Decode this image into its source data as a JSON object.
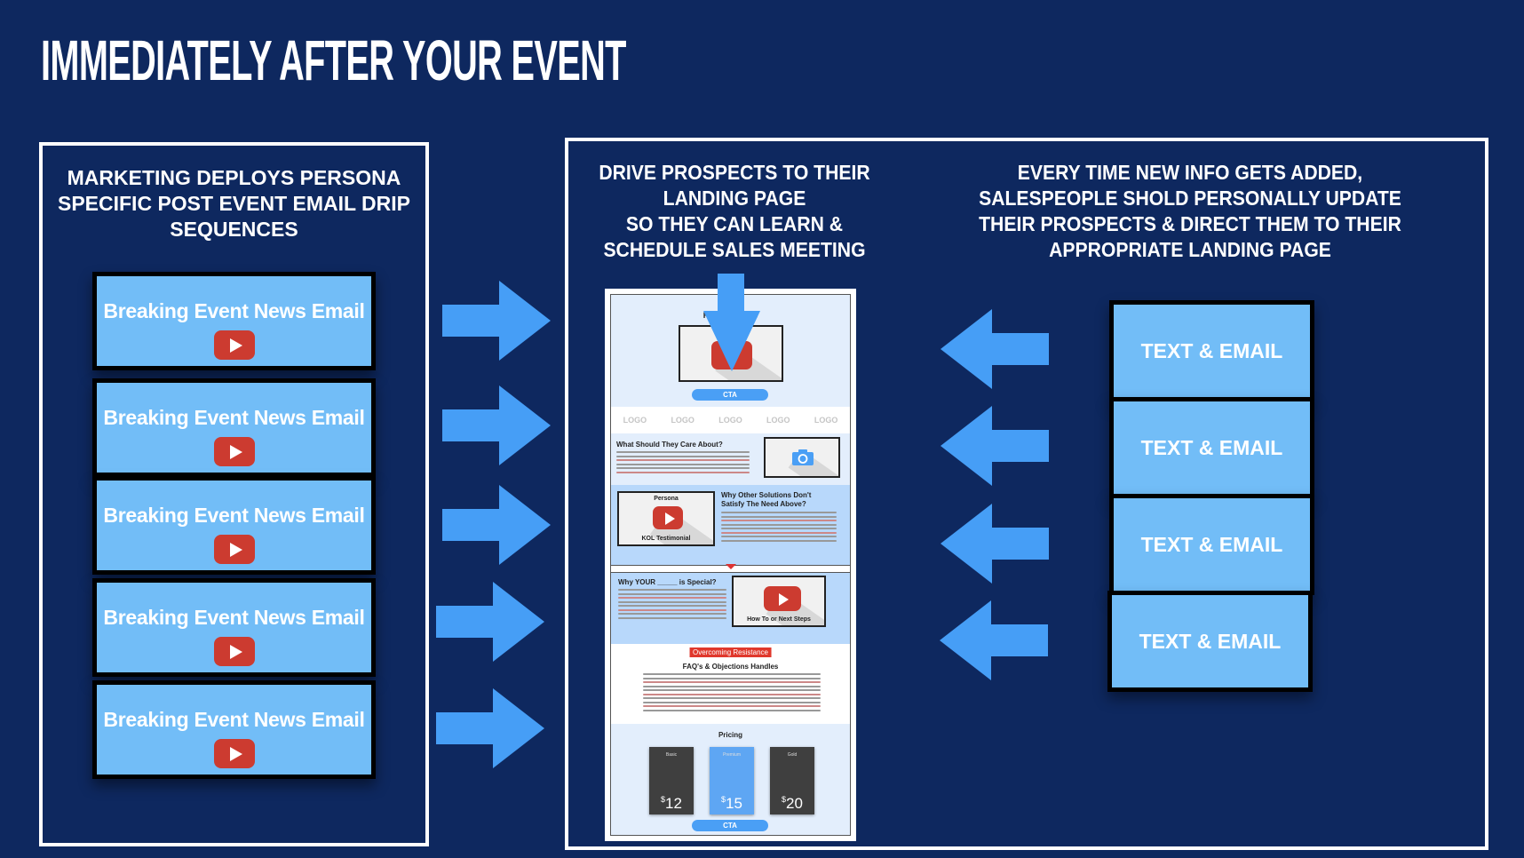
{
  "title": "IMMEDIATELY AFTER YOUR EVENT",
  "left_panel": {
    "heading_lines": [
      "MARKETING DEPLOYS PERSONA",
      "SPECIFIC POST EVENT EMAIL DRIP",
      "SEQUENCES"
    ],
    "emails": [
      {
        "label": "Breaking Event News Email",
        "icon": "youtube-play-icon"
      },
      {
        "label": "Breaking Event News Email",
        "icon": "youtube-play-icon"
      },
      {
        "label": "Breaking Event News Email",
        "icon": "youtube-play-icon"
      },
      {
        "label": "Breaking Event News Email",
        "icon": "youtube-play-icon"
      },
      {
        "label": "Breaking Event News Email",
        "icon": "youtube-play-icon"
      }
    ]
  },
  "middle": {
    "heading_lines": [
      "DRIVE PROSPECTS TO THEIR",
      "LANDING PAGE",
      "SO THEY CAN LEARN &",
      "SCHEDULE SALES MEETING"
    ]
  },
  "right": {
    "heading_lines": [
      "EVERY TIME NEW INFO GETS ADDED,",
      "SALESPEOPLE SHOLD PERSONALLY UPDATE",
      "THEIR PROSPECTS & DIRECT THEM TO THEIR",
      "APPROPRIATE LANDING PAGE"
    ],
    "cards": [
      {
        "label": "TEXT & EMAIL"
      },
      {
        "label": "TEXT & EMAIL"
      },
      {
        "label": "TEXT & EMAIL"
      },
      {
        "label": "TEXT & EMAIL"
      }
    ]
  },
  "landing_page": {
    "hero_title": "Persona         Value",
    "hero_cta": "CTA",
    "logos": [
      "LOGO",
      "LOGO",
      "LOGO",
      "LOGO",
      "LOGO"
    ],
    "care_title": "What Should They Care About?",
    "kol_top": "Persona",
    "kol_bottom": "KOL Testimonial",
    "why_title_1": "Why Other Solutions Don't",
    "why_title_2": "Satisfy The Need Above?",
    "special_title": "Why YOUR _____ is Special?",
    "next_steps": "How To or Next Steps",
    "overcoming": "Overcoming Resistance",
    "faq_title": "FAQ's & Objections Handles",
    "pricing_title": "Pricing",
    "plans": [
      {
        "name": "Basic",
        "price": "12"
      },
      {
        "name": "Premium",
        "price": "15"
      },
      {
        "name": "Gold",
        "price": "20"
      }
    ],
    "currency": "$",
    "bottom_cta": "CTA"
  },
  "colors": {
    "background": "#0e285f",
    "card_fill": "#72bdf7",
    "arrow": "#469ef6",
    "youtube_red": "#cc3b30"
  }
}
